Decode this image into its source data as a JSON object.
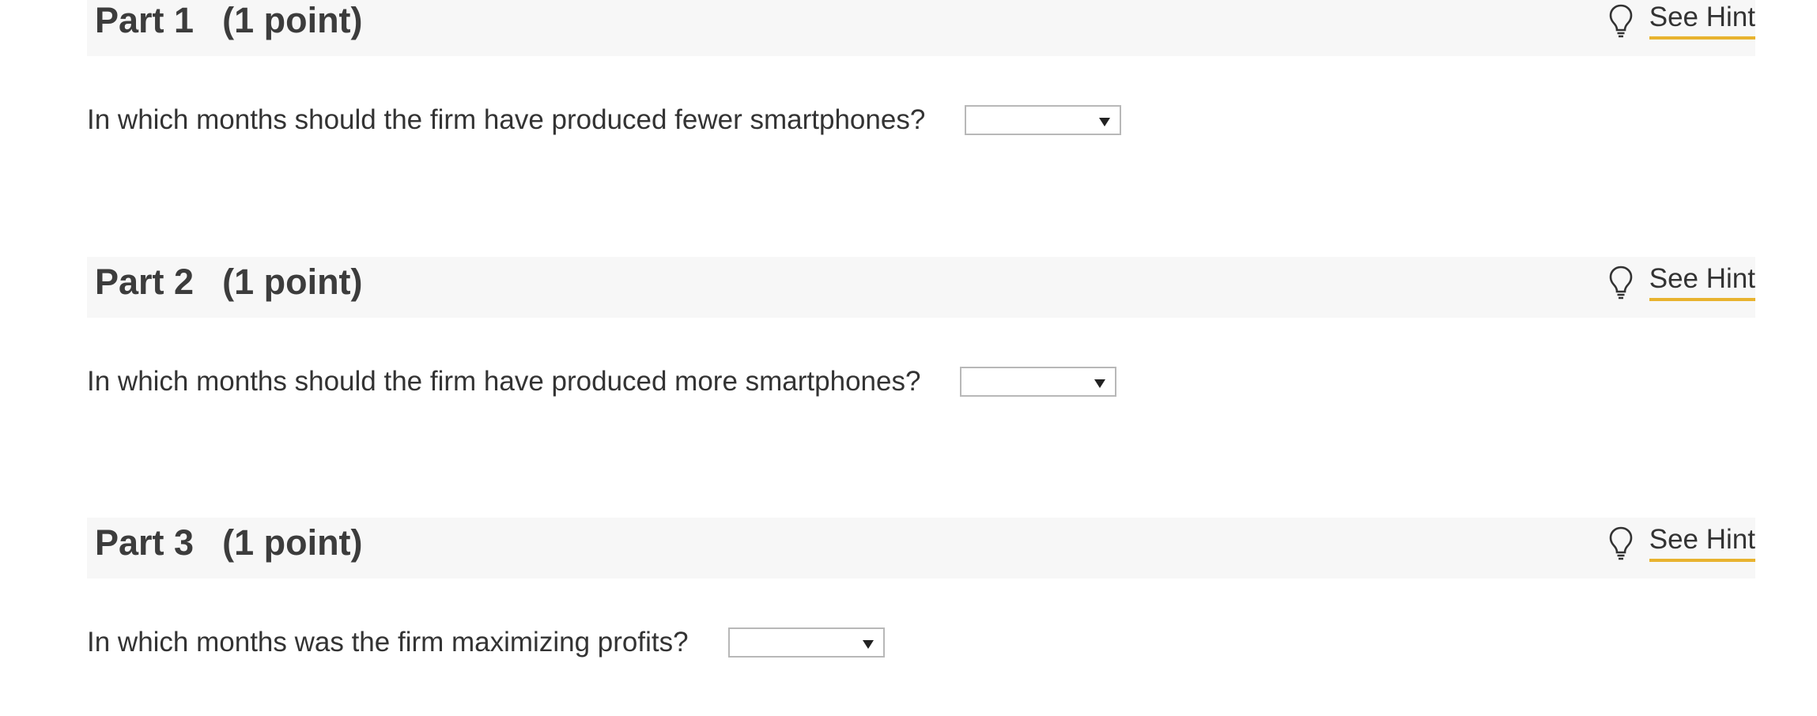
{
  "parts": [
    {
      "title": "Part 1",
      "points": "(1 point)",
      "hint_label": "See Hint",
      "question": "In which months should the firm have produced fewer smartphones?",
      "selected": ""
    },
    {
      "title": "Part 2",
      "points": "(1 point)",
      "hint_label": "See Hint",
      "question": "In which months should the firm have produced more smartphones?",
      "selected": ""
    },
    {
      "title": "Part 3",
      "points": "(1 point)",
      "hint_label": "See Hint",
      "question": "In which months was the firm maximizing profits?",
      "selected": ""
    }
  ],
  "icons": {
    "hint": "lightbulb-icon",
    "dropdown": "chevron-down-icon"
  },
  "colors": {
    "header_bg": "#f7f7f7",
    "hint_underline": "#e8b32f",
    "text": "#333333"
  }
}
